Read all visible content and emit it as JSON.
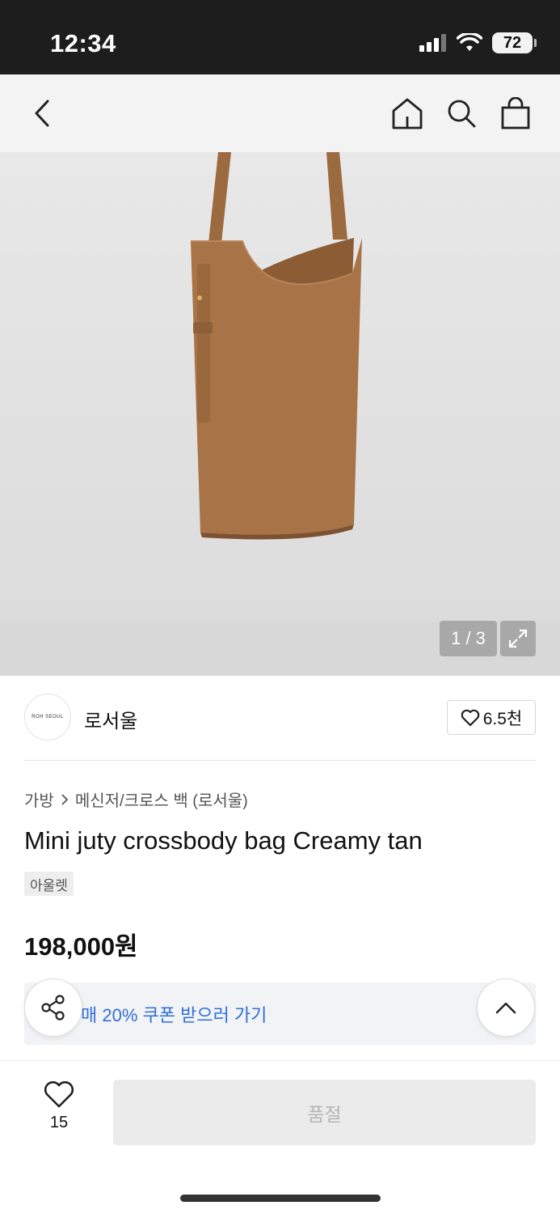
{
  "status_bar": {
    "time": "12:34",
    "battery": "72"
  },
  "top_nav": {
    "icons": [
      "back-arrow-icon",
      "home-icon",
      "search-icon",
      "shopping-bag-icon"
    ]
  },
  "gallery": {
    "counter": "1 / 3",
    "bag_color": "#a87346"
  },
  "brand": {
    "logo_text": "ROH SEOUL",
    "name": "로서울",
    "likes": "6.5천"
  },
  "product": {
    "breadcrumb": {
      "category": "가방",
      "subcategory": "메신저/크로스 백 (로서울)"
    },
    "title": "Mini juty crossbody bag Creamy tan",
    "tag": "아울렛",
    "price": "198,000원"
  },
  "coupon": {
    "text": "매 20% 쿠폰 받으러 가기",
    "color": "#2f6fdb"
  },
  "bottom_bar": {
    "wish_count": "15",
    "soldout_label": "품절"
  }
}
